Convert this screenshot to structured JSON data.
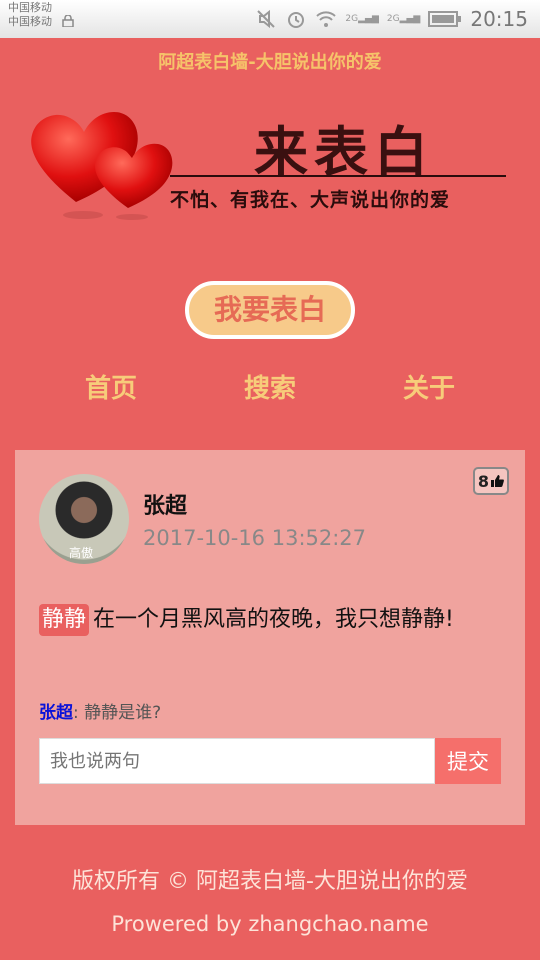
{
  "status_bar": {
    "carrier_1": "中国移动",
    "carrier_2": "中国移动",
    "net_1": "2G",
    "net_2": "2G",
    "time": "20:15"
  },
  "header": {
    "site_title": "阿超表白墙-大胆说出你的爱",
    "logo_title": "来表白",
    "logo_subtitle": "不怕、有我在、大声说出你的爱"
  },
  "confess_button": "我要表白",
  "nav": {
    "home": "首页",
    "search": "搜索",
    "about": "关于"
  },
  "post": {
    "avatar_caption": "高傲",
    "author": "张超",
    "timestamp": "2017-10-16 13:52:27",
    "likes": "8",
    "target": "静静",
    "message": "在一个月黑风高的夜晚，我只想静静!",
    "comment_author": "张超",
    "comment_sep": ":",
    "comment_text": "静静是谁?",
    "comment_placeholder": "我也说两句",
    "submit_label": "提交"
  },
  "footer": {
    "copyright": "版权所有 © 阿超表白墙-大胆说出你的爱",
    "powered": "Prowered by zhangchao.name"
  },
  "colors": {
    "background": "#e9605f",
    "accent": "#f7cc7a",
    "card": "#f0a39e"
  }
}
